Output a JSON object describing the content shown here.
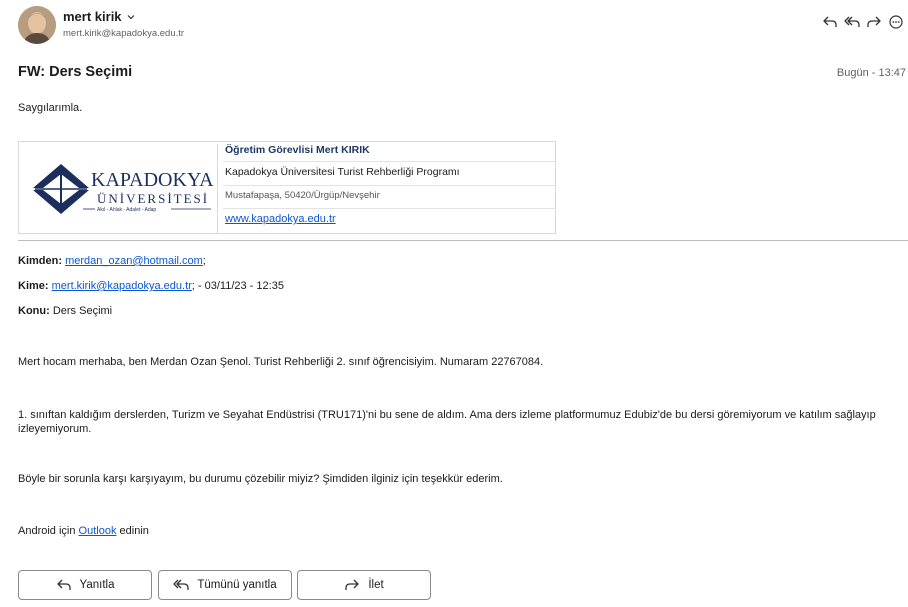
{
  "header": {
    "sender_name": "mert kirik",
    "sender_email": "mert.kirik@kapadokya.edu.tr",
    "actions": [
      "reply-icon",
      "reply-all-icon",
      "forward-icon",
      "more-icon"
    ]
  },
  "message": {
    "subject": "FW: Ders Seçimi",
    "date": "Bugün - 13:47",
    "greeting": "Saygılarımla."
  },
  "signature": {
    "logo": {
      "line1": "KAPADOKYA",
      "line2": "ÜNİVERSİTESİ",
      "motto": "Akıl - Ahlak - Adalet - Adap"
    },
    "name": "Öğretim Görevlisi Mert KIRIK",
    "program": "Kapadokya Üniversitesi Turist Rehberliği Programı",
    "address": "Mustafapaşa, 50420/Ürgüp/Nevşehir",
    "website": "www.kapadokya.edu.tr"
  },
  "forwarded": {
    "from_label": "Kimden:",
    "from_value": "merdan_ozan@hotmail.com",
    "from_suffix": ";",
    "to_label": "Kime:",
    "to_value": "mert.kirik@kapadokya.edu.tr",
    "to_suffix": "; - 03/11/23 - 12:35",
    "subject_label": "Konu:",
    "subject_value": "Ders Seçimi"
  },
  "body": {
    "p1": "Mert hocam merhaba, ben Merdan Ozan Şenol. Turist Rehberliği 2. sınıf öğrencisiyim. Numaram 22767084.",
    "p2": "1. sınıftan kaldığım derslerden, Turizm ve Seyahat Endüstrisi (TRU171)'ni bu sene de aldım. Ama ders izleme platformumuz Edubiz'de bu dersi göremiyorum ve katılım sağlayıp izleyemiyorum.",
    "p3": "Böyle bir sorunla karşı karşıyayım, bu durumu çözebilir miyiz? Şimdiden ilginiz için teşekkür ederim.",
    "outlook_prefix": "Android için",
    "outlook_link": "Outlook",
    "outlook_suffix": "edinin"
  },
  "buttons": {
    "reply": "Yanıtla",
    "reply_all": "Tümünü yanıtla",
    "forward": "İlet"
  },
  "colors": {
    "link": "#0b57d0",
    "signature_name": "#1f3864",
    "logo_navy": "#1c2f5c"
  }
}
